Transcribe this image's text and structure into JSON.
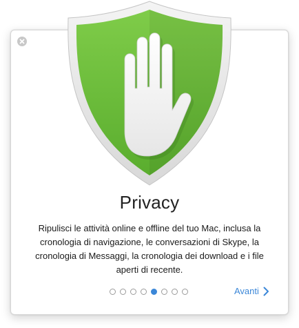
{
  "dialog": {
    "title": "Privacy",
    "description": "Ripulisci le attività online e offline del tuo Mac, inclusa la cronologia di navigazione, le conversazioni di Skype, la cronologia di Messaggi, la cronologia dei download e i file aperti di recente.",
    "next_label": "Avanti",
    "colors": {
      "shield_green": "#6cbd3c",
      "accent_blue": "#3b87d8"
    },
    "pagination": {
      "total": 8,
      "current": 5
    }
  }
}
